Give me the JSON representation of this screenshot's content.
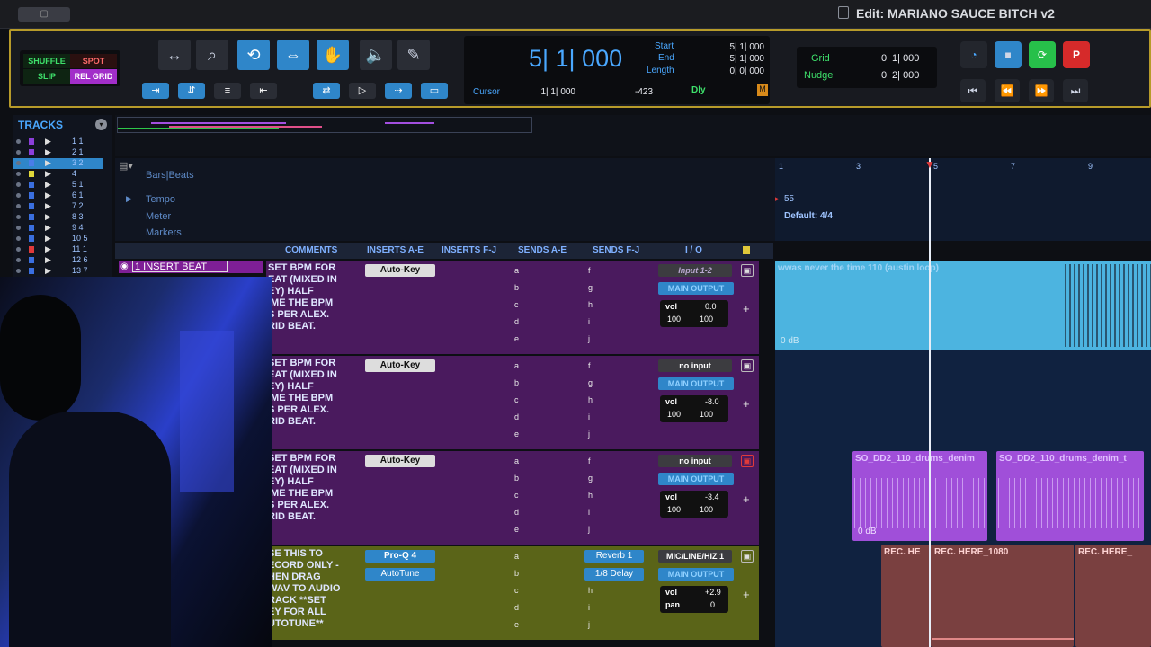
{
  "window": {
    "title": "Edit: MARIANO SAUCE BITCH v2"
  },
  "modes": [
    "SHUFFLE",
    "SPOT",
    "SLIP",
    "REL GRID"
  ],
  "counter": {
    "main": "5| 1| 000",
    "start_label": "Start",
    "end_label": "End",
    "length_label": "Length",
    "start": "5| 1| 000",
    "end": "5| 1| 000",
    "length": "0| 0| 000",
    "cursor_label": "Cursor",
    "cursor": "1| 1| 000",
    "cursor_offset": "-423",
    "dly": "Dly"
  },
  "grid": {
    "grid_label": "Grid",
    "grid_value": "0| 1| 000",
    "nudge_label": "Nudge",
    "nudge_value": "0| 2| 000"
  },
  "tracks_panel": {
    "title": "TRACKS",
    "items": [
      {
        "num": "1 1",
        "color": "#8b3fd9"
      },
      {
        "num": "2 1",
        "color": "#8b3fd9"
      },
      {
        "num": "3 2",
        "color": "#4a7de8"
      },
      {
        "num": "4",
        "color": "#e0d83a"
      },
      {
        "num": "5 1",
        "color": "#3a6fe0"
      },
      {
        "num": "6 1",
        "color": "#3a6fe0"
      },
      {
        "num": "7 2",
        "color": "#3a6fe0"
      },
      {
        "num": "8 3",
        "color": "#3a6fe0"
      },
      {
        "num": "9 4",
        "color": "#3a6fe0"
      },
      {
        "num": "10 5",
        "color": "#3a6fe0"
      },
      {
        "num": "11 1",
        "color": "#e03a3a"
      },
      {
        "num": "12 6",
        "color": "#3a6fe0"
      },
      {
        "num": "13 7",
        "color": "#3a6fe0"
      }
    ]
  },
  "rulers": {
    "bars_beats": "Bars|Beats",
    "tempo": "Tempo",
    "meter": "Meter",
    "markers": "Markers",
    "tempo_value": "55",
    "meter_value": "Default: 4/4",
    "bar_labels": [
      "1",
      "3",
      "5",
      "7",
      "9"
    ]
  },
  "columns": [
    "COMMENTS",
    "INSERTS A-E",
    "INSERTS F-J",
    "SENDS A-E",
    "SENDS F-J",
    "I / O"
  ],
  "insert_beat_name": "1 INSERT BEAT",
  "sends_left": [
    "a",
    "b",
    "c",
    "d",
    "e"
  ],
  "sends_right": [
    "f",
    "g",
    "h",
    "i",
    "j"
  ],
  "track_rows": [
    {
      "comment": "SET BPM FOR\nEAT (MIXED IN\nEY) HALF\nIME THE BPM\nS PER ALEX.\nRID BEAT.",
      "insert": "Auto-Key",
      "input": "Input 1-2",
      "output": "MAIN OUTPUT",
      "vol": "0.0",
      "pan_l": "100",
      "pan_r": "100"
    },
    {
      "comment": "SET BPM FOR\nEAT (MIXED IN\nEY) HALF\nIME THE BPM\nS PER ALEX.\nRID BEAT.",
      "insert": "Auto-Key",
      "input": "no input",
      "output": "MAIN OUTPUT",
      "vol": "-8.0",
      "pan_l": "100",
      "pan_r": "100"
    },
    {
      "comment": "SET BPM FOR\nEAT (MIXED IN\nEY) HALF\nIME THE BPM\nS PER ALEX.\nRID BEAT.",
      "insert": "Auto-Key",
      "input": "no input",
      "output": "MAIN OUTPUT",
      "vol": "-3.4",
      "pan_l": "100",
      "pan_r": "100"
    },
    {
      "comment": "SE THIS TO\nECORD ONLY -\nHEN DRAG\nWAV TO AUDIO\nRACK **SET\nEY FOR ALL\nUTOTUNE**",
      "insert": "Pro-Q 4",
      "insert2": "AutoTune",
      "send_f": "Reverb 1",
      "send_g": "1/8 Delay",
      "input": "MIC/LINE/HIZ 1",
      "output": "MAIN OUTPUT",
      "vol": "+2.9",
      "pan_label": "pan",
      "pan": "0"
    }
  ],
  "clips": {
    "clip1": "wwas never the time 110 (austin loop)",
    "clip1_gain": "0 dB",
    "clip2a": "SO_DD2_110_drums_denim",
    "clip2b": "SO_DD2_110_drums_denim_t",
    "clip2_gain": "0 dB",
    "rec1": "REC. HE",
    "rec2": "REC. HERE_1080",
    "rec3": "REC. HERE_"
  },
  "vol_label": "vol"
}
